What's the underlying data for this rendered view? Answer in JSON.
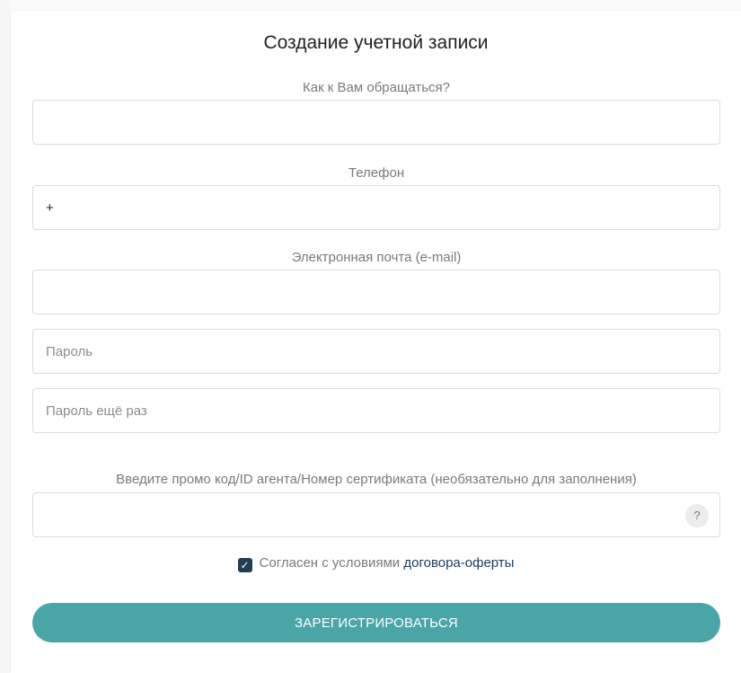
{
  "form": {
    "title": "Создание учетной записи",
    "name_label": "Как к Вам обращаться?",
    "name_value": "",
    "phone_label": "Телефон",
    "phone_value": "+",
    "email_label": "Электронная почта (e-mail)",
    "email_value": "",
    "password_placeholder": "Пароль",
    "password_repeat_placeholder": "Пароль ещё раз",
    "promo_label": "Введите промо код/ID агента/Номер сертификата (необязательно для заполнения)",
    "promo_value": "",
    "promo_help": "?",
    "agree_checked": true,
    "agree_check_glyph": "✓",
    "agree_text": "Согласен с условиями",
    "agree_link": "договора-оферты",
    "submit_label": "ЗАРЕГИСТРИРОВАТЬСЯ"
  },
  "colors": {
    "accent": "#4aa5a7",
    "checkbox": "#213e56",
    "link": "#1f3b57"
  }
}
